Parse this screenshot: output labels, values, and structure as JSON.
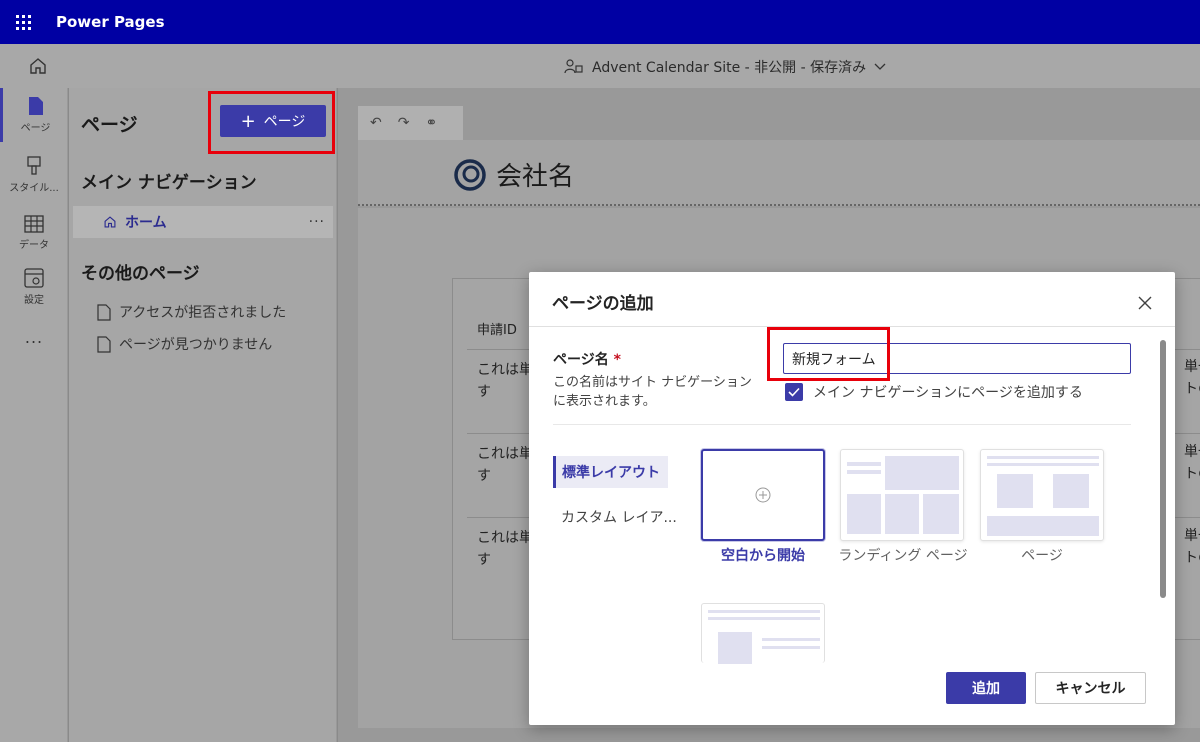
{
  "app": {
    "title": "Power Pages"
  },
  "site": {
    "name": "Advent Calendar Site - 非公開 - 保存済み"
  },
  "rail": {
    "items": [
      {
        "label": "ページ",
        "icon": "page-icon"
      },
      {
        "label": "スタイル...",
        "icon": "paintbrush-icon"
      },
      {
        "label": "データ",
        "icon": "table-icon"
      },
      {
        "label": "設定",
        "icon": "settings-icon"
      }
    ],
    "more": "..."
  },
  "panel": {
    "title": "ページ",
    "add_button": "ページ",
    "main_nav_heading": "メイン ナビゲーション",
    "home_label": "ホーム",
    "home_more": "...",
    "other_heading": "その他のページ",
    "other_pages": [
      "アクセスが拒否されました",
      "ページが見つかりません"
    ]
  },
  "preview": {
    "company": "会社名",
    "table_header": "申請ID",
    "rows": [
      "これは単\nす",
      "これは単\nす",
      "これは単\nす"
    ],
    "right_rows": [
      "単一\nトの",
      "単一\nトの",
      "単一\nトの"
    ]
  },
  "dialog": {
    "title": "ページの追加",
    "name_label": "ページ名",
    "required_mark": "*",
    "name_desc": "この名前はサイト ナビゲーションに表示されます。",
    "name_value": "新規フォーム",
    "checkbox_label": "メイン ナビゲーションにページを追加する",
    "checkbox_checked": true,
    "tabs": [
      "標準レイアウト",
      "カスタム レイア..."
    ],
    "templates": [
      {
        "label": "空白から開始",
        "selected": true
      },
      {
        "label": "ランディング ページ",
        "selected": false
      },
      {
        "label": "ページ",
        "selected": false
      }
    ],
    "add_button": "追加",
    "cancel_button": "キャンセル"
  },
  "colors": {
    "accent": "#3b3ba8",
    "topbar": "#0000a3",
    "highlight": "#e8000b"
  }
}
